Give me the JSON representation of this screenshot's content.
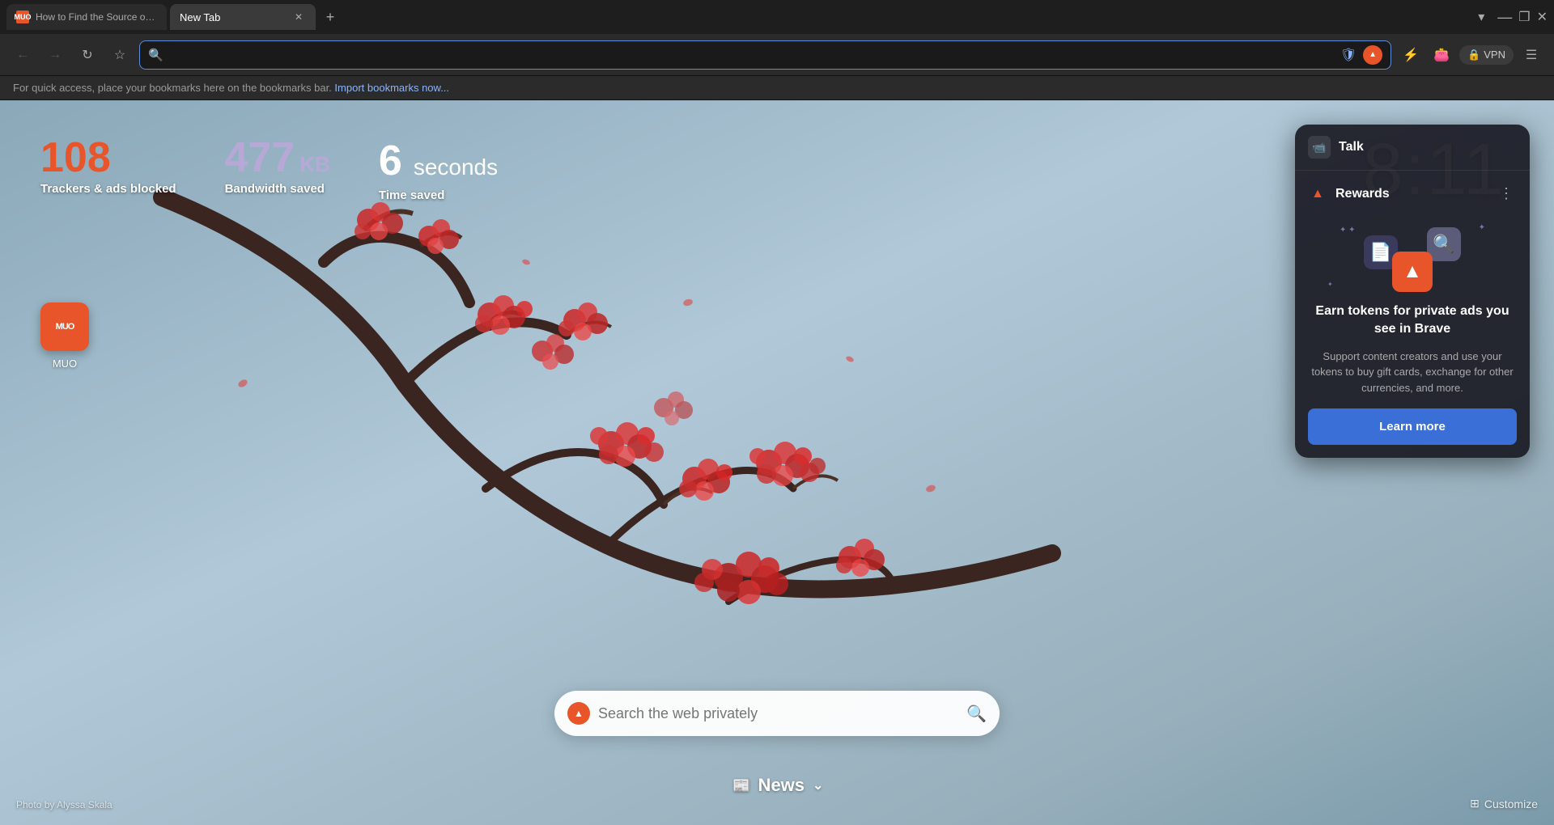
{
  "browser": {
    "tabs": [
      {
        "id": "tab-1",
        "label": "How to Find the Source of a Video...",
        "favicon": "MUO",
        "active": false
      },
      {
        "id": "tab-2",
        "label": "New Tab",
        "favicon": "",
        "active": true
      }
    ],
    "new_tab_label": "+",
    "tab_list_label": "▾",
    "minimize_label": "—",
    "maximize_label": "❐",
    "close_label": "✕",
    "nav": {
      "back_label": "←",
      "forward_label": "→",
      "reload_label": "↻",
      "bookmark_label": "☆",
      "address_placeholder": "",
      "shield_label": "🛡",
      "vpn_label": "VPN"
    },
    "bookmarks_bar": {
      "message": "For quick access, place your bookmarks here on the bookmarks bar.",
      "import_link": "Import bookmarks now..."
    }
  },
  "new_tab": {
    "stats": {
      "trackers_count": "108",
      "trackers_label": "Trackers & ads blocked",
      "bandwidth_number": "477",
      "bandwidth_unit": "KB",
      "bandwidth_label": "Bandwidth saved",
      "time_number": "6",
      "time_unit": "seconds",
      "time_label": "Time saved"
    },
    "clock": "8:11",
    "shortcut": {
      "label": "MUO",
      "favicon": "MUO"
    },
    "search": {
      "placeholder": "Search the web privately",
      "icon": "🔍"
    },
    "news": {
      "label": "News",
      "icon": "📰",
      "chevron": "⌄"
    },
    "photo_credit": "Photo by Alyssa Skala",
    "customize_label": "Customize",
    "customize_icon": "⊞"
  },
  "rewards_panel": {
    "talk": {
      "label": "Talk",
      "icon": "📹"
    },
    "rewards": {
      "label": "Rewards",
      "more_icon": "⋮",
      "earn_text": "Earn tokens for private ads you see in Brave",
      "desc_text": "Support content creators and use your tokens to buy gift cards, exchange for other currencies, and more.",
      "learn_more_label": "Learn more"
    }
  }
}
